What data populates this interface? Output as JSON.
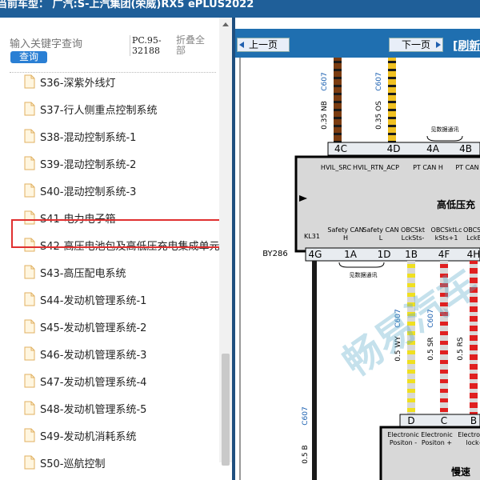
{
  "header": {
    "title": "当前车型： 广汽:S-上汽集团(荣威)RX5 ePLUS2022"
  },
  "sidebar": {
    "search_placeholder": "输入关键字查询",
    "search_button": "查询",
    "pc_code": "PC.95-32188",
    "collapse_all": "折叠全部",
    "items": [
      {
        "label": "S36-深紫外线灯"
      },
      {
        "label": "S37-行人侧重点控制系统"
      },
      {
        "label": "S38-混动控制系统-1"
      },
      {
        "label": "S39-混动控制系统-2"
      },
      {
        "label": "S40-混动控制系统-3"
      },
      {
        "label": "S41-电力电子箱"
      },
      {
        "label": "S42-高压电池包及高低压充电集成单元"
      },
      {
        "label": "S43-高压配电系统"
      },
      {
        "label": "S44-发动机管理系统-1"
      },
      {
        "label": "S45-发动机管理系统-2"
      },
      {
        "label": "S46-发动机管理系统-3"
      },
      {
        "label": "S47-发动机管理系统-4"
      },
      {
        "label": "S48-发动机管理系统-5"
      },
      {
        "label": "S49-发动机消耗系统"
      },
      {
        "label": "S50-巡航控制"
      }
    ],
    "selected_index": 6
  },
  "viewer": {
    "prev_label": "上一页",
    "next_label": "下一页",
    "refresh_label": "[刷新",
    "diagram": {
      "wire_codes": [
        "C607",
        "C607",
        "C607",
        "C607",
        "C607"
      ],
      "wire_specs": [
        "0.35 NB",
        "0.35 OS",
        "0.5 WY",
        "0.5 SR",
        "0.5 RS",
        "0.5 B"
      ],
      "top_pins": [
        "4C",
        "4D",
        "4A",
        "4B"
      ],
      "top_note": "见数据通讯",
      "block_title": "高低压充",
      "block_signals_top": [
        "HVIL_SRC",
        "HVIL_RTN_ACP",
        "PT CAN H",
        "PT CAN"
      ],
      "block_signals_bottom": [
        "KL31",
        "Safety CAN H",
        "Safety CAN L",
        "OBCSkt LckSts-",
        "OBCSktLc kSts+1",
        "OBCSkt LckEr"
      ],
      "connector": "BY286",
      "bottom_pins": [
        "4G",
        "1A",
        "1D",
        "1B",
        "4F",
        "4H"
      ],
      "bottom_note": "见数据通讯",
      "lower_pins": [
        "D",
        "C",
        "B"
      ],
      "lower_signals": [
        "Electronic Positon -",
        "Electronic Positon +",
        "Electronic lock-"
      ],
      "lower_title": "慢速",
      "watermark": "畅易汽车"
    }
  }
}
